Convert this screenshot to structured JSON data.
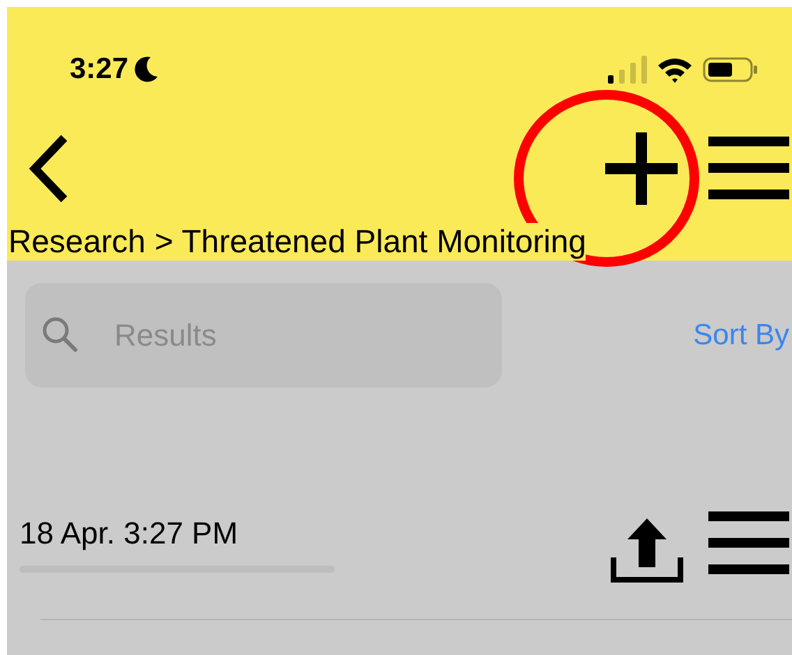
{
  "status_bar": {
    "time": "3:27"
  },
  "nav_bar": {
    "breadcrumb": "Research > Threatened Plant Monitoring"
  },
  "search": {
    "placeholder": "Results"
  },
  "sort_button": {
    "label": "Sort By"
  },
  "rows": [
    {
      "date": "18 Apr. 3:27 PM"
    }
  ]
}
